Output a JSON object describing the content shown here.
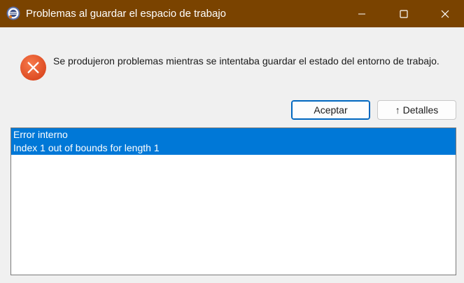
{
  "window": {
    "title": "Problemas al guardar el espacio de trabajo",
    "titlebar_color": "#7a4300",
    "app_icon": "eclipse-app-icon"
  },
  "dialog": {
    "icon": "error-icon",
    "message": "Se produjeron problemas mientras se intentaba guardar el estado del entorno de trabajo.",
    "buttons": {
      "accept_label": "Aceptar",
      "details_label": "↑ Detalles"
    },
    "details": {
      "items": [
        {
          "text": "Error interno",
          "selected": true
        },
        {
          "text": "Index 1 out of bounds for length 1",
          "selected": true
        }
      ]
    }
  },
  "colors": {
    "error_red": "#e8542a",
    "selection_blue": "#0078d7",
    "accent_border": "#0067c0"
  }
}
